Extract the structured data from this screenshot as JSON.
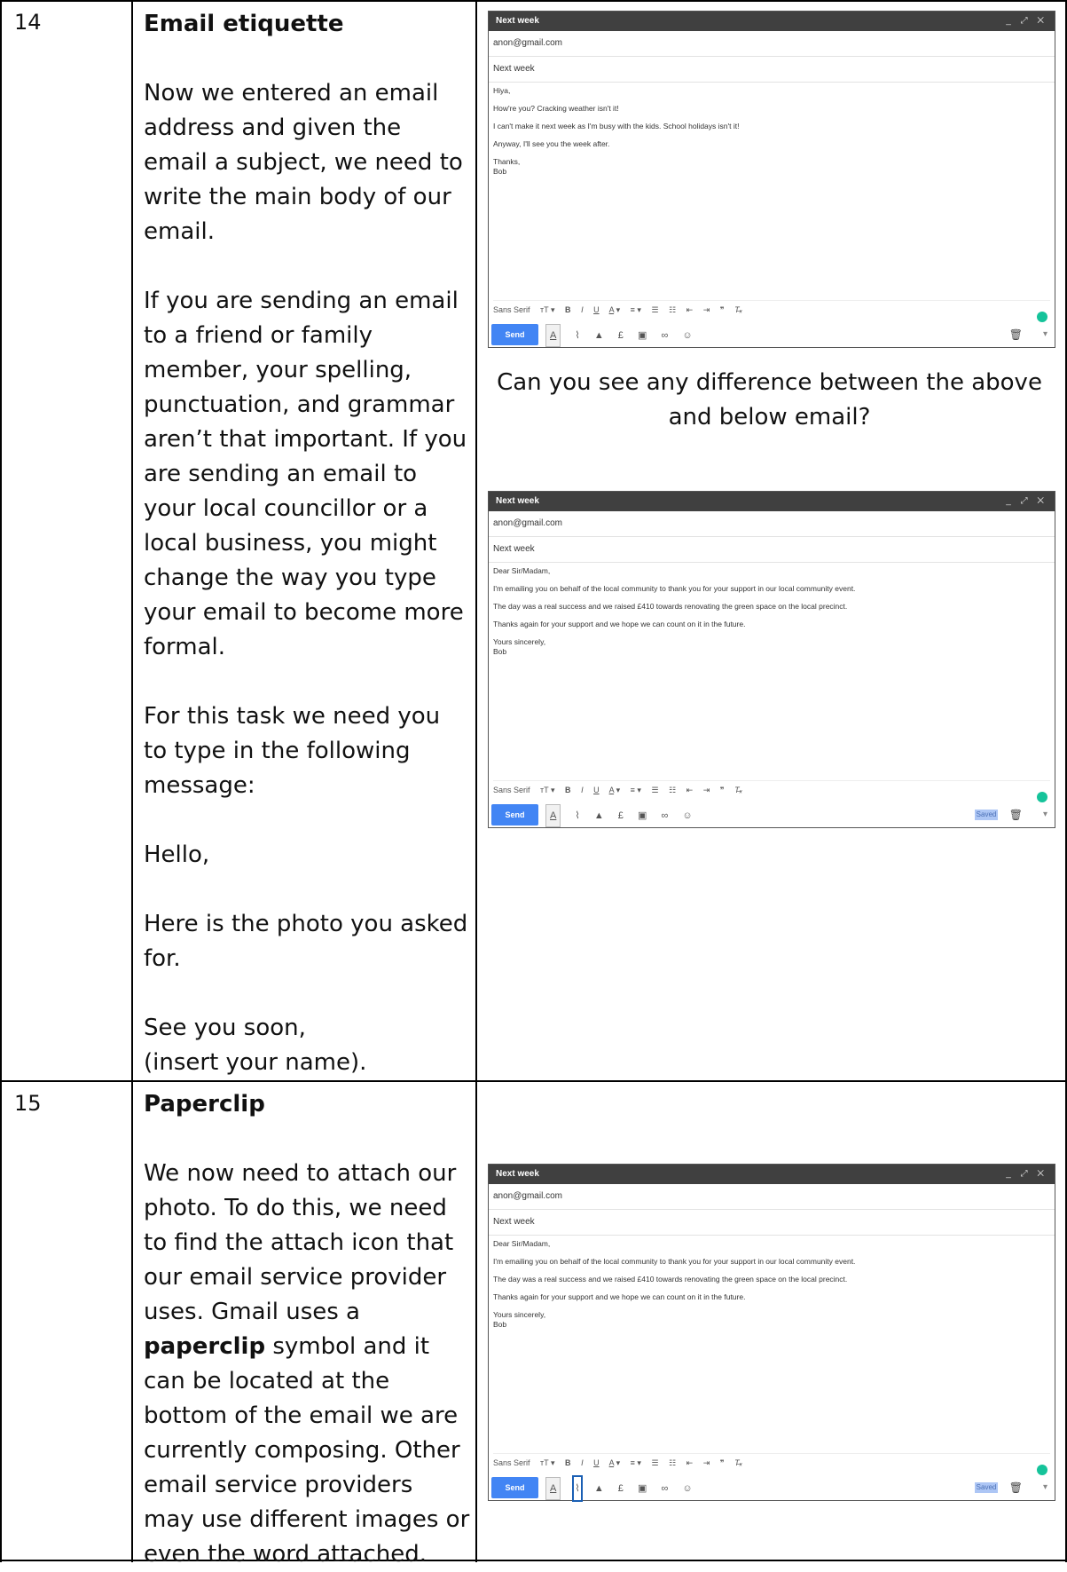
{
  "rows": [
    {
      "number": "14",
      "title": "Email etiquette",
      "paragraphs": [
        "Now we entered an email address and given the email a subject, we need to write the main body of our email.",
        "If you are sending an email to a friend or family member, your spelling, punctuation, and grammar aren’t that important. If you are sending an email to your local councillor or a local business, you might change the way you type your email to become more formal.",
        "For this task we need you to type in the following message:",
        "Hello,",
        "Here is the photo you asked for."
      ],
      "closing_line1": "See you soon,",
      "closing_line2": "(insert your name).",
      "question": "Can you see any difference between the above and below email?"
    },
    {
      "number": "15",
      "title": "Paperclip",
      "text_before": "We now need to attach our photo. To do this, we need to find the attach icon that our email service provider uses. Gmail uses a ",
      "bold_word": "paperclip",
      "text_after": " symbol and it can be located at the bottom of the email we are currently composing. Other email service providers may use different images or even the word attached."
    }
  ],
  "emails": {
    "informal": {
      "window_title": "Next week",
      "to": "anon@gmail.com",
      "subject": "Next week",
      "greeting": "Hiya,",
      "lines": [
        "How're you? Cracking weather isn't it!",
        "I can't make it next week as I'm busy with the kids. School holidays isn't it!",
        "Anyway, I'll see you the week after."
      ],
      "signoff1": "Thanks,",
      "signoff2": "Bob",
      "send_label": "Send"
    },
    "formal": {
      "window_title": "Next week",
      "to": "anon@gmail.com",
      "subject": "Next week",
      "greeting": "Dear Sir/Madam,",
      "lines": [
        "I'm emailing you on behalf of the local community to thank you for your support in our local community event.",
        "The day was a real success and we raised £410 towards renovating the green space on the local precinct.",
        "Thanks again for your support and we hope we can count on it in the future."
      ],
      "signoff1": "Yours sincerely,",
      "signoff2": "Bob",
      "send_label": "Send",
      "saved_label": "Saved"
    },
    "font_label": "Sans Serif",
    "win_controls": "_ ⤢ ✕"
  }
}
